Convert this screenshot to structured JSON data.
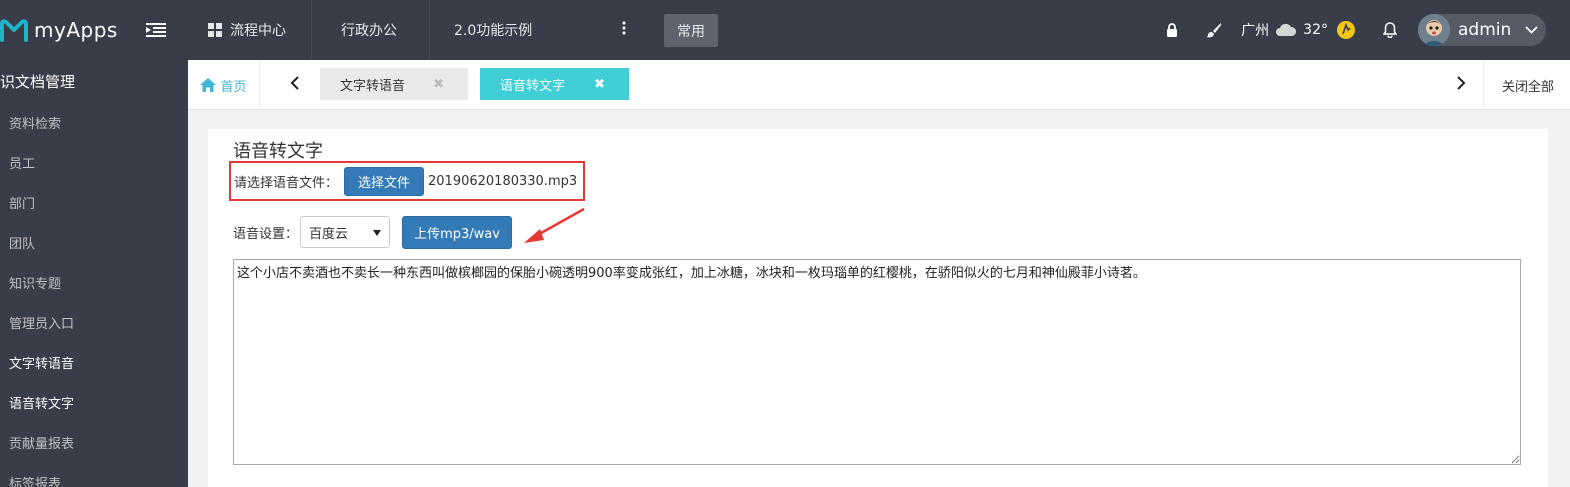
{
  "brand": {
    "name": "myApps"
  },
  "topnav": {
    "items": [
      {
        "label": "流程中心",
        "icon": "grid-icon"
      },
      {
        "label": "行政办公"
      },
      {
        "label": "2.0功能示例"
      }
    ],
    "more_icon": "vertical-dots-icon",
    "common_label": "常用"
  },
  "top_right": {
    "city": "广州",
    "temperature": "32°",
    "username": "admin",
    "icons": [
      "lock-icon",
      "brush-icon",
      "cloud-icon",
      "sun-icon",
      "bell-icon",
      "chevron-down-icon"
    ]
  },
  "sidebar": {
    "title": "识文档管理",
    "items": [
      {
        "label": "资料检索"
      },
      {
        "label": "员工"
      },
      {
        "label": "部门"
      },
      {
        "label": "团队"
      },
      {
        "label": "知识专题"
      },
      {
        "label": "管理员入口"
      },
      {
        "label": "文字转语音"
      },
      {
        "label": "语音转文字"
      },
      {
        "label": "贡献量报表"
      },
      {
        "label": "标签报表"
      }
    ]
  },
  "tabbar": {
    "home_label": "首页",
    "tabs": [
      {
        "label": "文字转语音",
        "close": "✖"
      },
      {
        "label": "语音转文字",
        "close": "✖",
        "active": true
      }
    ],
    "close_all_label": "关闭全部"
  },
  "panel": {
    "title": "语音转文字",
    "file_label": "请选择语音文件：",
    "choose_button": "选择文件",
    "file_name": "20190620180330.mp3",
    "setting_label": "语音设置：",
    "engine_selected": "百度云",
    "upload_button": "上传mp3/wav",
    "result_text": "这个小店不卖酒也不卖长一种东西叫做槟榔园的保胎小碗透明900率变成张红，加上冰糖，冰块和一枚玛瑙单的红樱桃，在骄阳似火的七月和神仙殿菲小诗茗。"
  },
  "colors": {
    "topbar_bg": "#393d49",
    "brand_teal": "#1fb5c8",
    "active_tab": "#41cfd7",
    "primary_button": "#337ab7",
    "highlight_border": "#e53935"
  }
}
